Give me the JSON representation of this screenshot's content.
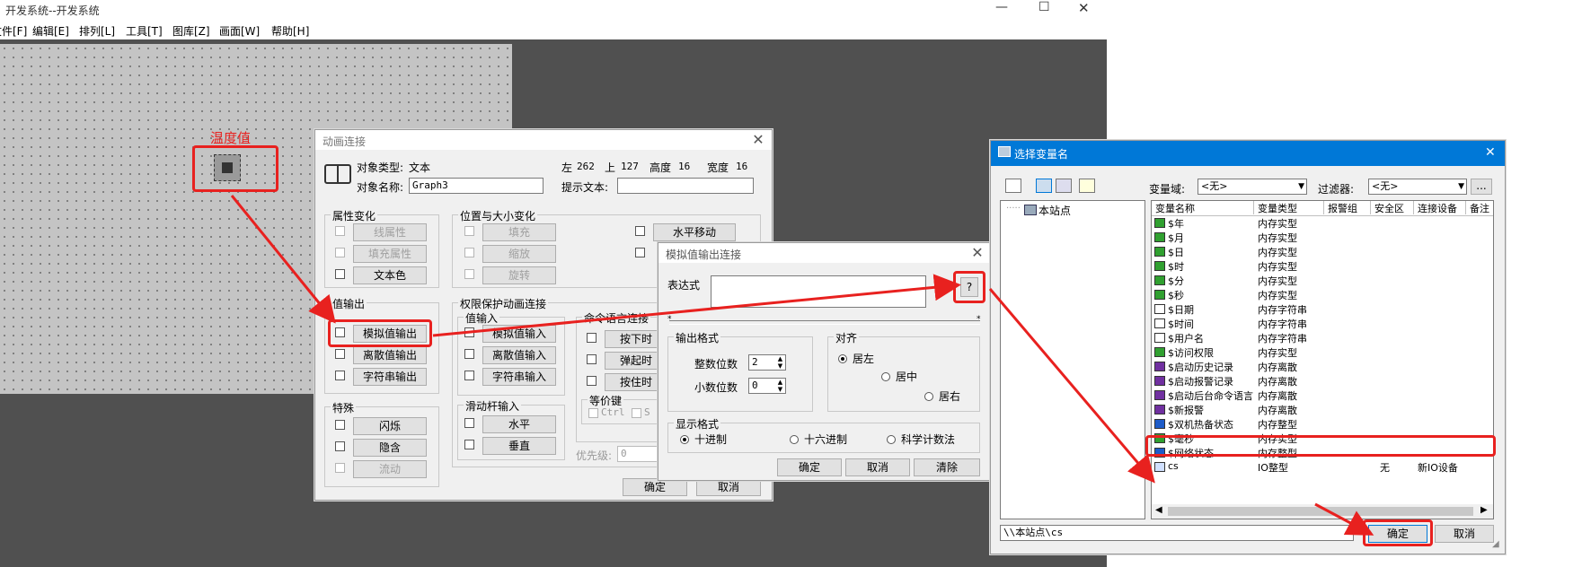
{
  "main_window": {
    "title": "开发系统--开发系统",
    "menu": [
      "文件[F]",
      "编辑[E]",
      "排列[L]",
      "工具[T]",
      "图库[Z]",
      "画面[W]",
      "帮助[H]"
    ],
    "canvas_label": "温度值"
  },
  "anim_dialog": {
    "title": "动画连接",
    "obj_type_label": "对象类型:",
    "obj_type_value": "文本",
    "obj_name_label": "对象名称:",
    "obj_name_value": "Graph3",
    "pos": {
      "left_label": "左",
      "left": "262",
      "top_label": "上",
      "top": "127",
      "height_label": "高度",
      "height": "16",
      "width_label": "宽度",
      "width": "16"
    },
    "hint_label": "提示文本:",
    "hint_value": "",
    "attr_group": {
      "title": "属性变化",
      "items": [
        "线属性",
        "填充属性",
        "文本色"
      ]
    },
    "pos_group": {
      "title": "位置与大小变化",
      "items": [
        "填充",
        "缩放",
        "旋转"
      ],
      "move_h": "水平移动"
    },
    "out_group": {
      "title": "值输出",
      "items": [
        "模拟值输出",
        "离散值输出",
        "字符串输出"
      ]
    },
    "perm_group": {
      "title": "权限保护动画连接"
    },
    "in_group": {
      "title": "值输入",
      "items": [
        "模拟值输入",
        "离散值输入",
        "字符串输入"
      ]
    },
    "cmd_group": {
      "title": "命令语言连接",
      "items": [
        "按下时",
        "弹起时",
        "按住时"
      ]
    },
    "equiv": {
      "title": "等价键",
      "ctrl": "Ctrl",
      "shift": "S"
    },
    "priority_label": "优先级:",
    "priority_value": "0",
    "special_group": {
      "title": "特殊",
      "items": [
        "闪烁",
        "隐含",
        "流动"
      ]
    },
    "slider_group": {
      "title": "滑动杆输入",
      "items": [
        "水平",
        "垂直"
      ]
    },
    "ok": "确定",
    "cancel": "取消"
  },
  "analog_dialog": {
    "title": "模拟值输出连接",
    "expr_label": "表达式",
    "expr_value": "",
    "q_button": "?",
    "out_format": {
      "title": "输出格式",
      "int_label": "整数位数",
      "int_value": "2",
      "dec_label": "小数位数",
      "dec_value": "0"
    },
    "align": {
      "title": "对齐",
      "left": "居左",
      "center": "居中",
      "right": "居右"
    },
    "display": {
      "title": "显示格式",
      "dec": "十进制",
      "hex": "十六进制",
      "sci": "科学计数法"
    },
    "ok": "确定",
    "cancel": "取消",
    "clear": "清除"
  },
  "var_dialog": {
    "title": "选择变量名",
    "domain_label": "变量域:",
    "domain_value": "<无>",
    "filter_label": "过滤器:",
    "filter_value": "<无>",
    "more_button": "...",
    "tree_root": "本站点",
    "columns": [
      "变量名称",
      "变量类型",
      "报警组",
      "安全区",
      "连接设备",
      "备注"
    ],
    "rows": [
      {
        "name": "$年",
        "type": "内存实型",
        "icon": "real",
        "group": "",
        "zone": "",
        "device": ""
      },
      {
        "name": "$月",
        "type": "内存实型",
        "icon": "real",
        "group": "",
        "zone": "",
        "device": ""
      },
      {
        "name": "$日",
        "type": "内存实型",
        "icon": "real",
        "group": "",
        "zone": "",
        "device": ""
      },
      {
        "name": "$时",
        "type": "内存实型",
        "icon": "real",
        "group": "",
        "zone": "",
        "device": ""
      },
      {
        "name": "$分",
        "type": "内存实型",
        "icon": "real",
        "group": "",
        "zone": "",
        "device": ""
      },
      {
        "name": "$秒",
        "type": "内存实型",
        "icon": "real",
        "group": "",
        "zone": "",
        "device": ""
      },
      {
        "name": "$日期",
        "type": "内存字符串",
        "icon": "string",
        "group": "",
        "zone": "",
        "device": ""
      },
      {
        "name": "$时间",
        "type": "内存字符串",
        "icon": "string",
        "group": "",
        "zone": "",
        "device": ""
      },
      {
        "name": "$用户名",
        "type": "内存字符串",
        "icon": "string",
        "group": "",
        "zone": "",
        "device": ""
      },
      {
        "name": "$访问权限",
        "type": "内存实型",
        "icon": "real",
        "group": "",
        "zone": "",
        "device": ""
      },
      {
        "name": "$启动历史记录",
        "type": "内存离散",
        "icon": "discrete",
        "group": "",
        "zone": "",
        "device": ""
      },
      {
        "name": "$启动报警记录",
        "type": "内存离散",
        "icon": "discrete",
        "group": "",
        "zone": "",
        "device": ""
      },
      {
        "name": "$启动后台命令语言",
        "type": "内存离散",
        "icon": "discrete",
        "group": "",
        "zone": "",
        "device": ""
      },
      {
        "name": "$新报警",
        "type": "内存离散",
        "icon": "discrete",
        "group": "",
        "zone": "",
        "device": ""
      },
      {
        "name": "$双机热备状态",
        "type": "内存整型",
        "icon": "int",
        "group": "",
        "zone": "",
        "device": ""
      },
      {
        "name": "$毫秒",
        "type": "内存实型",
        "icon": "real",
        "group": "",
        "zone": "",
        "device": ""
      },
      {
        "name": "$网络状态",
        "type": "内存整型",
        "icon": "int",
        "group": "",
        "zone": "",
        "device": ""
      },
      {
        "name": "cs",
        "type": "IO整型",
        "icon": "io",
        "group": "",
        "zone": "无",
        "device": "新IO设备"
      }
    ],
    "path_value": "\\\\本站点\\cs",
    "ok": "确定",
    "cancel": "取消"
  },
  "colors": {
    "highlight": "#e8211f",
    "titlebar_blue": "#0078d7",
    "canvas": "#c0c0c0",
    "dark_bg": "#505050"
  }
}
